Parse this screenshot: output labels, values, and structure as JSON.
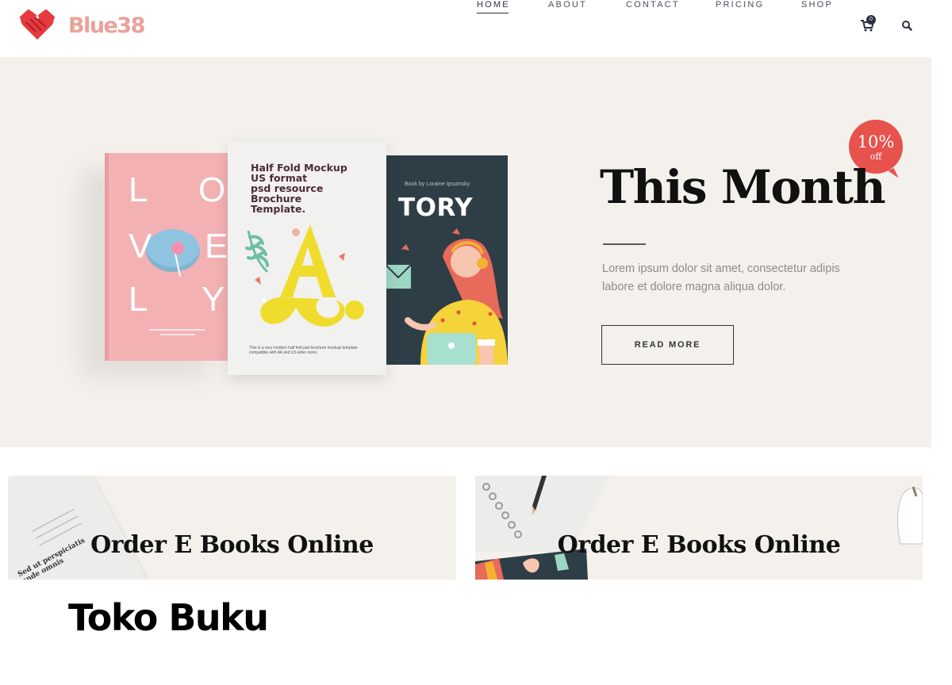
{
  "brand": {
    "name": "Blue38",
    "accent": "#eaa29a",
    "logo_icon": "heart-logo-icon"
  },
  "nav": {
    "items": [
      {
        "label": "HOME",
        "active": true
      },
      {
        "label": "ABOUT",
        "active": false
      },
      {
        "label": "CONTACT",
        "active": false
      },
      {
        "label": "PRICING",
        "active": false
      },
      {
        "label": "SHOP",
        "active": false
      }
    ],
    "cart_count": "0",
    "cart_icon": "cart-icon",
    "search_icon": "search-icon"
  },
  "hero": {
    "background": "#f4f1ec",
    "title": "This Month",
    "badge": {
      "percent": "10%",
      "label": "off",
      "color": "#e8524d"
    },
    "text": "Lorem ipsum dolor sit amet, consectetur adipis labore et dolore magna aliqua dolor.",
    "button_label": "READ MORE",
    "books": {
      "pink": {
        "letters": [
          "L",
          "O",
          "V",
          "E",
          "L",
          "Y"
        ]
      },
      "white": {
        "title": "Half Fold Mockup\nUS format\npsd resource\nBrochure\nTemplate.",
        "footnote": "This is a very modern half fold psd brochure mockup template compatible with A4 and US letter sizes."
      },
      "dark": {
        "byline": "Book by Loraine Ipsumsky",
        "title": "TORY"
      }
    }
  },
  "banners": [
    {
      "title": "Order E Books Online",
      "paper_text": "Sed ut perspiciatis\nunde omnis"
    },
    {
      "title": "Order E Books Online"
    }
  ],
  "footer_title": "Toko Buku"
}
